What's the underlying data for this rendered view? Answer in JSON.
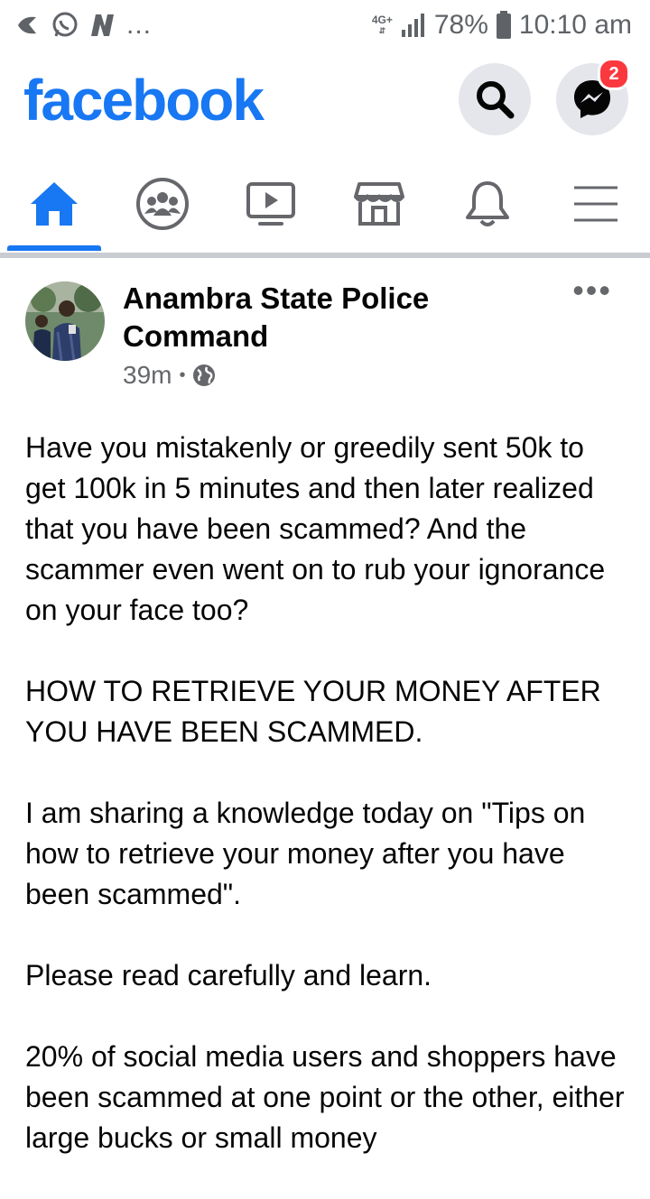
{
  "status_bar": {
    "network": "4G+",
    "battery": "78%",
    "time": "10:10 am",
    "dots": "..."
  },
  "header": {
    "logo": "facebook",
    "messenger_badge": "2"
  },
  "tabs": [
    {
      "name": "home",
      "active": true
    },
    {
      "name": "groups",
      "active": false
    },
    {
      "name": "watch",
      "active": false
    },
    {
      "name": "marketplace",
      "active": false
    },
    {
      "name": "notifications",
      "active": false
    },
    {
      "name": "menu",
      "active": false
    }
  ],
  "post": {
    "author_line1": "Anambra State Police",
    "author_line2": "Command",
    "time": "39m",
    "separator": "•",
    "paragraphs": [
      "Have you mistakenly or greedily sent 50k to get 100k in 5 minutes and then later realized that you have been scammed? And the scammer even went on to rub your ignorance on your face too?",
      "HOW TO RETRIEVE YOUR MONEY AFTER YOU HAVE BEEN SCAMMED.",
      "I am sharing a knowledge today on \"Tips on how to retrieve your money after you have been scammed\".",
      "Please read carefully and learn.",
      "20% of social media users and shoppers have been scammed at one point or the other, either large bucks or small money"
    ]
  },
  "colors": {
    "brand": "#1877f2",
    "badge": "#fa383e",
    "icon_bg": "#e4e6eb",
    "divider": "#c9ccd1"
  }
}
